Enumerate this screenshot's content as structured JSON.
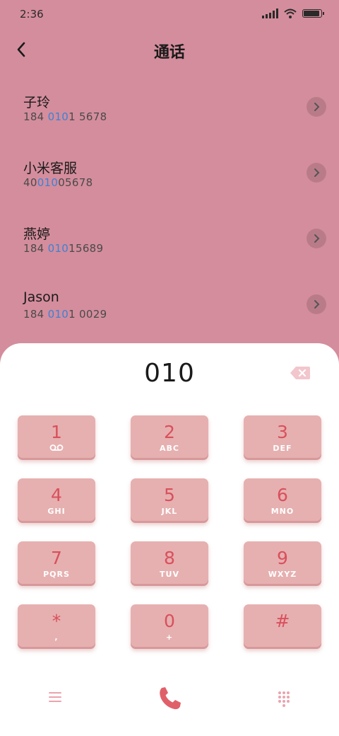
{
  "status_bar": {
    "time": "2:36"
  },
  "header": {
    "title": "通话"
  },
  "contacts": [
    {
      "name": "子玲",
      "number_pre": "184 ",
      "number_match": "010",
      "number_post": "1 5678"
    },
    {
      "name": "小米客服",
      "number_pre": "40",
      "number_match": "010",
      "number_post": "05678"
    },
    {
      "name": "燕婷",
      "number_pre": "184 ",
      "number_match": "010",
      "number_post": "15689"
    },
    {
      "name": "Jason",
      "number_pre": "184 ",
      "number_match": "010",
      "number_post": "1 0029"
    }
  ],
  "dialer": {
    "display": "010",
    "keys": [
      {
        "digit": "1",
        "letters": ""
      },
      {
        "digit": "2",
        "letters": "ABC"
      },
      {
        "digit": "3",
        "letters": "DEF"
      },
      {
        "digit": "4",
        "letters": "GHI"
      },
      {
        "digit": "5",
        "letters": "JKL"
      },
      {
        "digit": "6",
        "letters": "MNO"
      },
      {
        "digit": "7",
        "letters": "PQRS"
      },
      {
        "digit": "8",
        "letters": "TUV"
      },
      {
        "digit": "9",
        "letters": "WXYZ"
      },
      {
        "digit": "*",
        "letters": ","
      },
      {
        "digit": "0",
        "letters": "+"
      },
      {
        "digit": "#",
        "letters": ""
      }
    ]
  },
  "icons": {
    "back": "chevron-left-icon",
    "contact_detail": "chevron-right-icon",
    "delete": "backspace-icon",
    "voicemail": "voicemail-icon",
    "menu": "menu-icon",
    "call": "phone-icon",
    "keypad": "dialpad-icon"
  },
  "colors": {
    "background": "#d48d9c",
    "key": "#e6b0b0",
    "digit": "#d9505c",
    "match_highlight": "#3b82d6",
    "call": "#e0606a"
  }
}
